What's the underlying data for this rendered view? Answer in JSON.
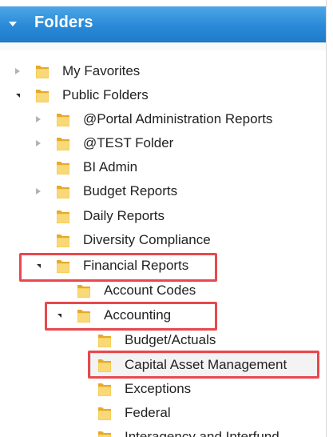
{
  "panel": {
    "title": "Folders"
  },
  "tree": [
    {
      "label": "My Favorites"
    },
    {
      "label": "Public Folders"
    },
    {
      "label": "@Portal Administration Reports"
    },
    {
      "label": "@TEST Folder"
    },
    {
      "label": "BI Admin"
    },
    {
      "label": "Budget Reports"
    },
    {
      "label": "Daily Reports"
    },
    {
      "label": "Diversity Compliance"
    },
    {
      "label": "Financial Reports"
    },
    {
      "label": "Account Codes"
    },
    {
      "label": "Accounting"
    },
    {
      "label": "Budget/Actuals"
    },
    {
      "label": "Capital Asset Management"
    },
    {
      "label": "Exceptions"
    },
    {
      "label": "Federal"
    },
    {
      "label": "Interagency and Interfund"
    }
  ],
  "colors": {
    "header_blue": "#2a8ad8",
    "highlight_red": "#e8484e",
    "folder_yellow": "#f2c14a"
  },
  "icons": {
    "expand_collapsed": "triangle-right-icon",
    "expand_open": "triangle-down-icon",
    "folder": "folder-icon",
    "panel_collapse": "caret-down-icon"
  }
}
